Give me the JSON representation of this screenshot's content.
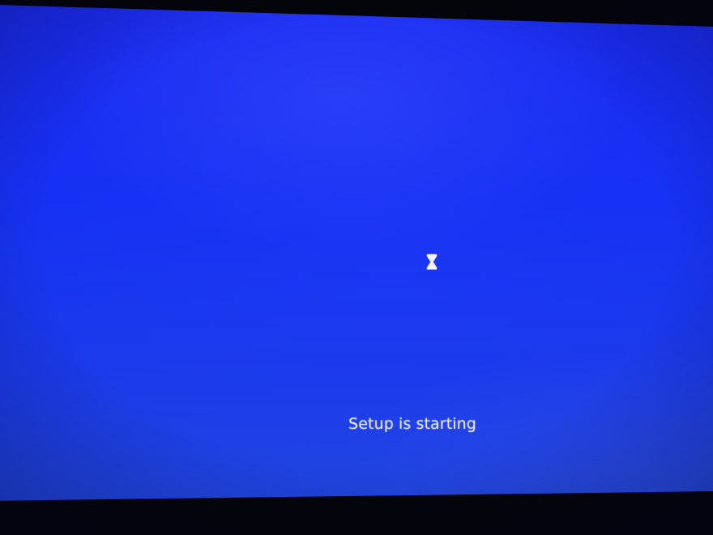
{
  "screen": {
    "status_text": "Setup is starting",
    "busy_icon": "hourglass-icon",
    "background_color": "#1631f3",
    "text_color": "#e6e8ff",
    "bezel_color": "#04050a"
  }
}
